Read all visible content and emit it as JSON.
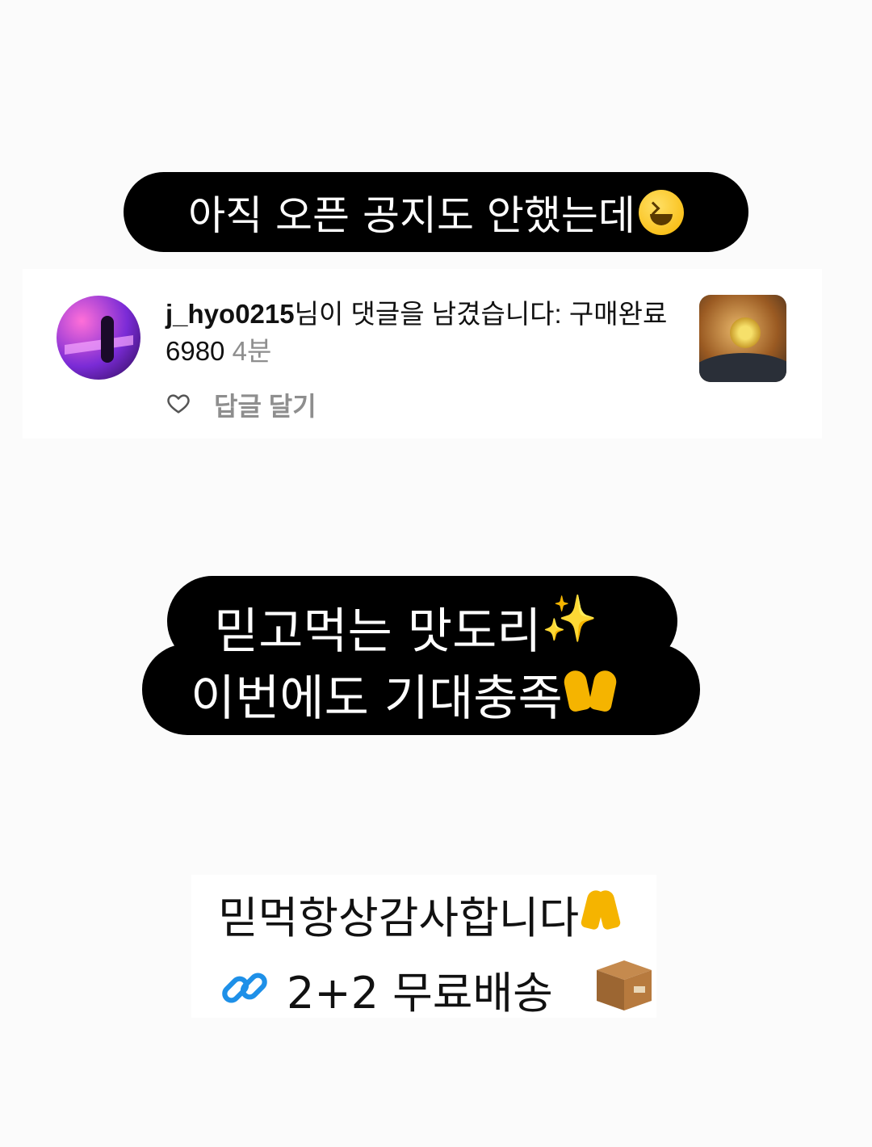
{
  "headline1": {
    "text": "아직 오픈 공지도 안했는데",
    "emoji": "laughing-face-icon"
  },
  "comment": {
    "username": "j_hyo0215",
    "message": "님이 댓글을 남겼습니다: 구매완료6980",
    "time": "4분",
    "reply_label": "답글 달기",
    "like_icon": "heart-icon"
  },
  "headline2": {
    "line1": "믿고먹는 맛도리",
    "line1_emoji": "✨",
    "line2": "이번에도 기대충족",
    "line2_emoji": "raised-hands-icon"
  },
  "footer": {
    "thanks": "믿먹항상감사합니다",
    "thanks_emoji": "folded-hands-icon",
    "shipping": "2+2 무료배송",
    "shipping_prefix_icon": "link-icon",
    "shipping_suffix_icon": "package-icon"
  }
}
